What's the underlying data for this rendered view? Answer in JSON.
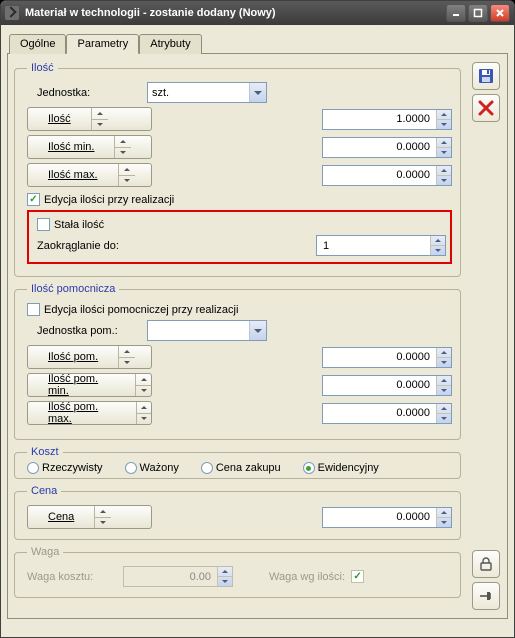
{
  "window": {
    "title": "Materiał w technologii - zostanie dodany  (Nowy)"
  },
  "tabs": {
    "ogolne": "Ogólne",
    "parametry": "Parametry",
    "atrybuty": "Atrybuty"
  },
  "ilosc": {
    "legend": "Ilość",
    "jednostka_label": "Jednostka:",
    "jednostka_value": "szt.",
    "ilosc_btn": "Ilość",
    "ilosc_val": "1.0000",
    "ilosc_min_btn": "Ilość min.",
    "ilosc_min_val": "0.0000",
    "ilosc_max_btn": "Ilość max.",
    "ilosc_max_val": "0.0000",
    "edycja_checkbox": "Edycja ilości przy realizacji",
    "stala_checkbox": "Stała ilość",
    "zaokraglanie_label": "Zaokrąglanie do:",
    "zaokraglanie_val": "1"
  },
  "pomoc": {
    "legend": "Ilość pomocnicza",
    "edycja_checkbox": "Edycja ilości pomocniczej przy realizacji",
    "jednostka_label": "Jednostka pom.:",
    "ilosc_btn": "Ilość pom.",
    "ilosc_val": "0.0000",
    "ilosc_min_btn": "Ilość pom. min.",
    "ilosc_min_val": "0.0000",
    "ilosc_max_btn": "Ilość pom. max.",
    "ilosc_max_val": "0.0000"
  },
  "koszt": {
    "legend": "Koszt",
    "rzecz": "Rzeczywisty",
    "wazony": "Ważony",
    "cena_zakupu": "Cena zakupu",
    "ewid": "Ewidencyjny"
  },
  "cena": {
    "legend": "Cena",
    "btn": "Cena",
    "val": "0.0000"
  },
  "waga": {
    "legend": "Waga",
    "kosztu_label": "Waga kosztu:",
    "kosztu_val": "0.00",
    "wg_label": "Waga wg ilości:"
  }
}
